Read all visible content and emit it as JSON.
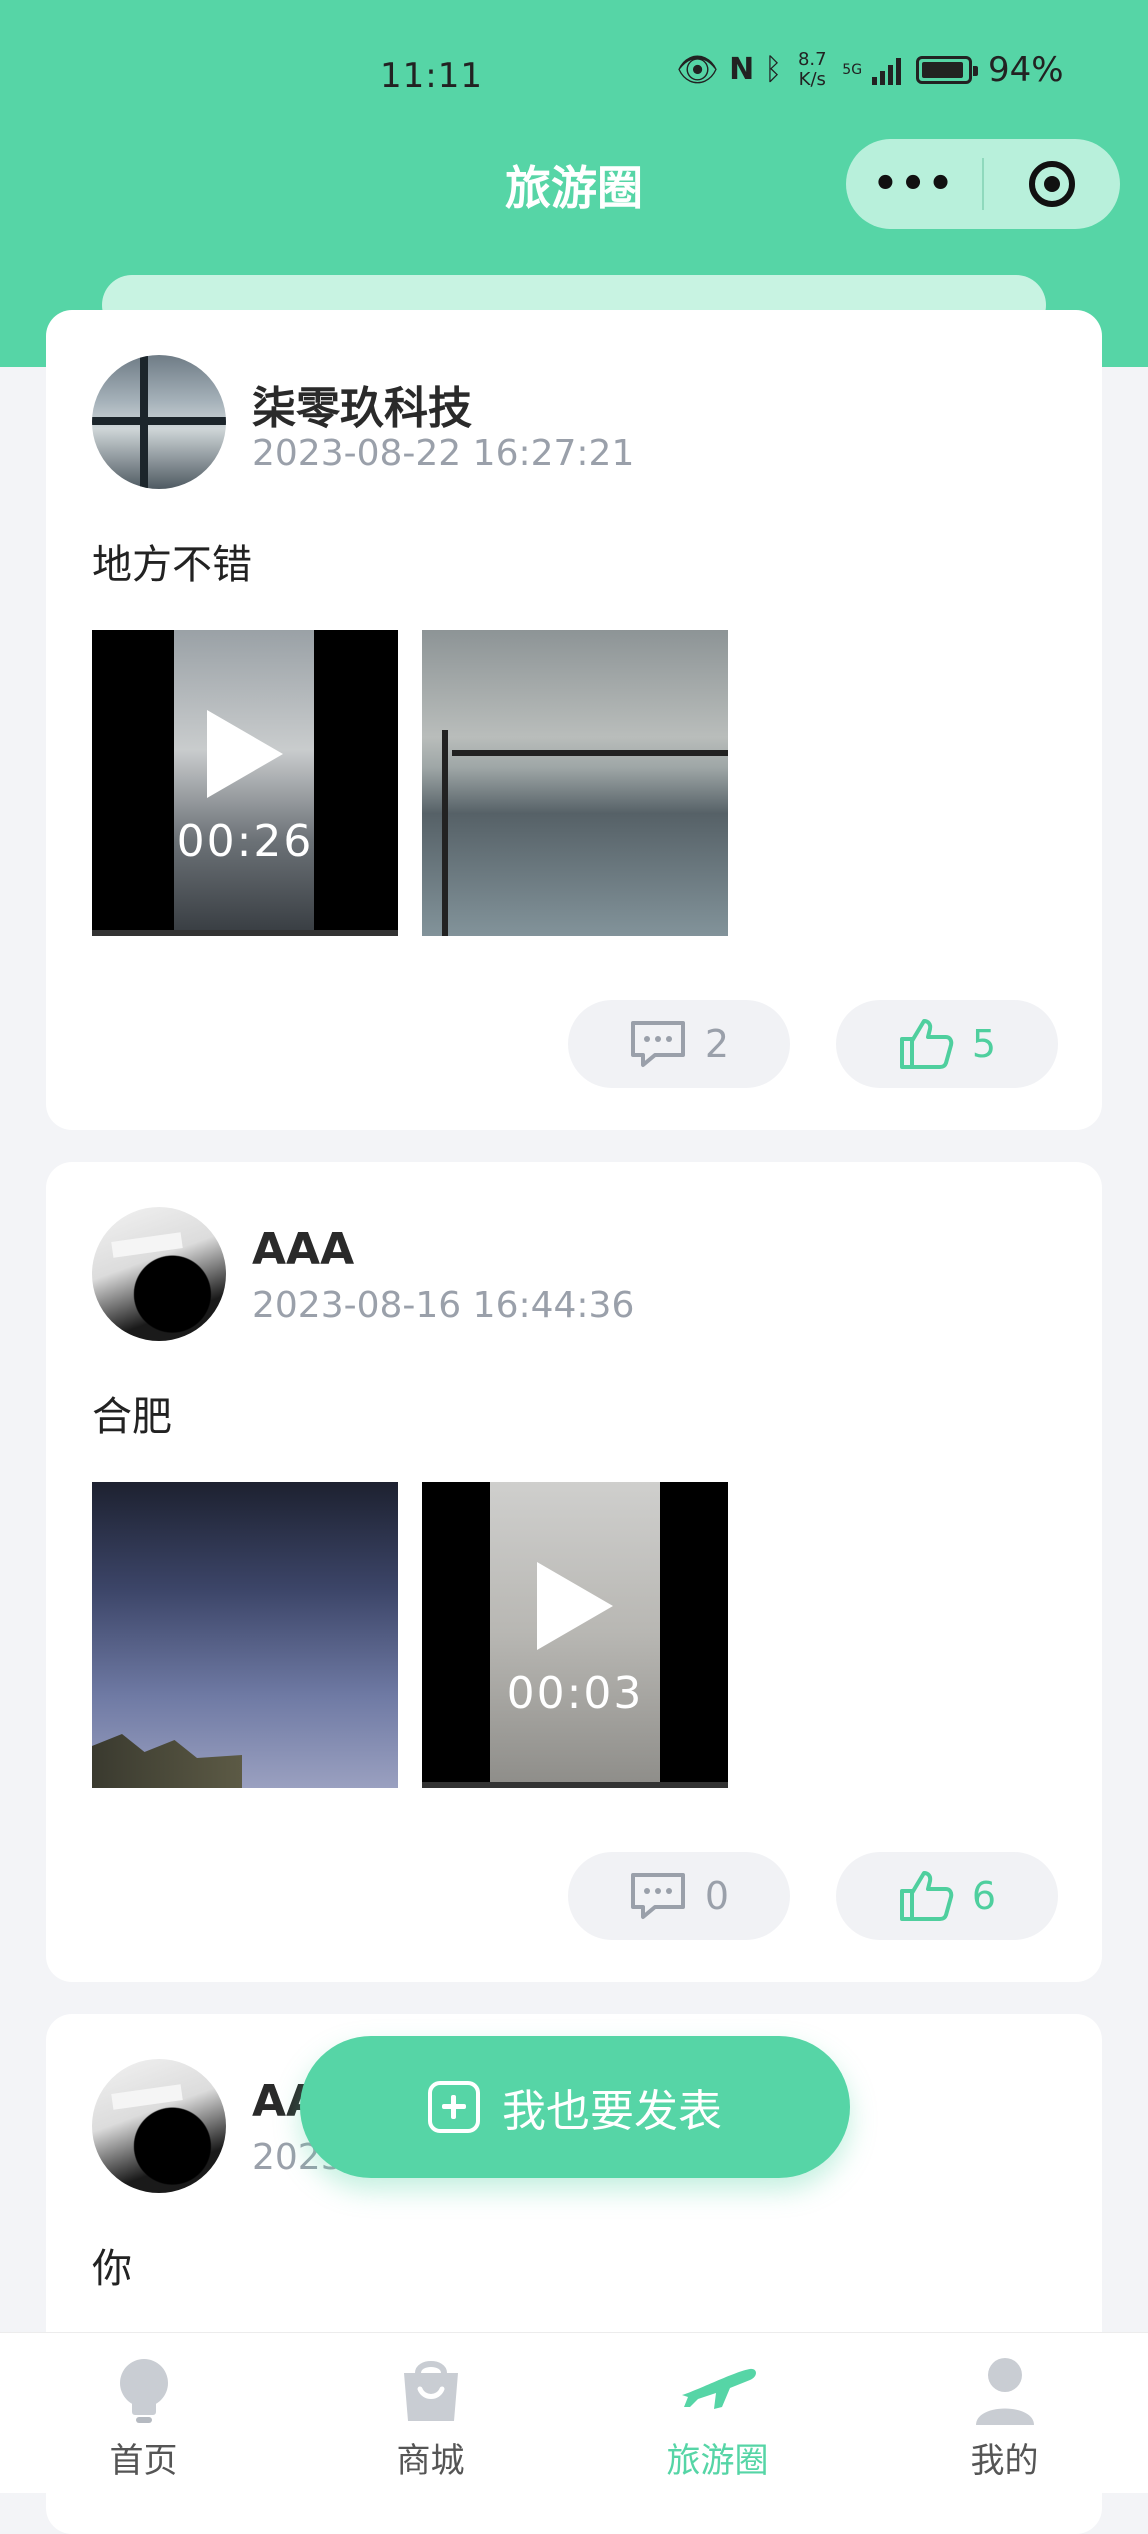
{
  "status_bar": {
    "time": "11:11",
    "net_speed_value": "8.7",
    "net_speed_unit": "K/s",
    "network_type": "5G",
    "battery_percent": "94%",
    "battery_level": 0.94
  },
  "header": {
    "title": "旅游圈",
    "capsule_more": "•••",
    "accent_color": "#56d5a6"
  },
  "posts": [
    {
      "username": "柒零玖科技",
      "time": "2023-08-22 16:27:21",
      "content": "地方不错",
      "media": [
        {
          "type": "video",
          "duration": "00:26"
        },
        {
          "type": "image"
        }
      ],
      "comments": "2",
      "likes": "5"
    },
    {
      "username": "AAA",
      "time": "2023-08-16 16:44:36",
      "content": "合肥",
      "media": [
        {
          "type": "image"
        },
        {
          "type": "video",
          "duration": "00:03"
        }
      ],
      "comments": "0",
      "likes": "6"
    },
    {
      "username_partial": "AA",
      "time_partial": "2023",
      "content": "你"
    }
  ],
  "fab": {
    "label": "我也要发表",
    "icon": "plus-square-icon"
  },
  "tabbar": {
    "items": [
      {
        "label": "首页",
        "icon": "lightbulb-icon"
      },
      {
        "label": "商城",
        "icon": "shopping-bag-icon"
      },
      {
        "label": "旅游圈",
        "icon": "airplane-icon",
        "active": true
      },
      {
        "label": "我的",
        "icon": "user-icon"
      }
    ]
  }
}
